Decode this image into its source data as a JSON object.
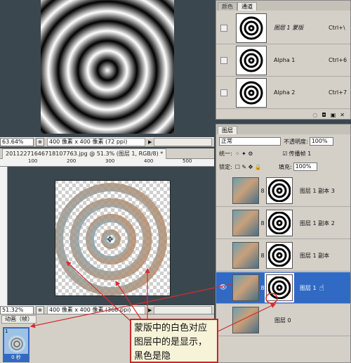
{
  "top_doc": {
    "zoom": "63.64%",
    "info": "400 像素 x 400 像素 (72 ppi)"
  },
  "main_doc": {
    "tab_title": "20112271646718107763.jpg @ 51.3% (图层 1, RGB/8) *",
    "zoom": "51.32%",
    "info": "400 像素 x 400 像素 (368 ppi)",
    "ruler_h": [
      "100",
      "200",
      "300",
      "400",
      "500"
    ]
  },
  "animation": {
    "tab_label": "动画（帧）",
    "frame_number": "1",
    "frame_time": "0 秒"
  },
  "channels_panel": {
    "tabs": [
      "颜色",
      "通道"
    ],
    "rows": [
      {
        "name": "图层 1 蒙版",
        "shortcut": "Ctrl+\\"
      },
      {
        "name": "Alpha 1",
        "shortcut": "Ctrl+6"
      },
      {
        "name": "Alpha 2",
        "shortcut": "Ctrl+7"
      }
    ]
  },
  "layers_panel": {
    "tab": "图层",
    "blend_mode": "正常",
    "opacity_label": "不透明度:",
    "opacity_value": "100%",
    "unify_label": "统一:",
    "propagate_label": "传播帧 1",
    "lock_label": "锁定:",
    "fill_label": "填充:",
    "fill_value": "100%",
    "layers": [
      {
        "name": "图层 1 副本 3"
      },
      {
        "name": "图层 1 副本 2"
      },
      {
        "name": "图层 1 副本"
      },
      {
        "name": "图层 1"
      },
      {
        "name": "图层 0"
      }
    ]
  },
  "annotation": {
    "text": "蒙版中的白色对应图层中的是显示，黑色是隐"
  },
  "colors": {
    "selection": "#316ac5",
    "arrow": "#d32f2f"
  }
}
